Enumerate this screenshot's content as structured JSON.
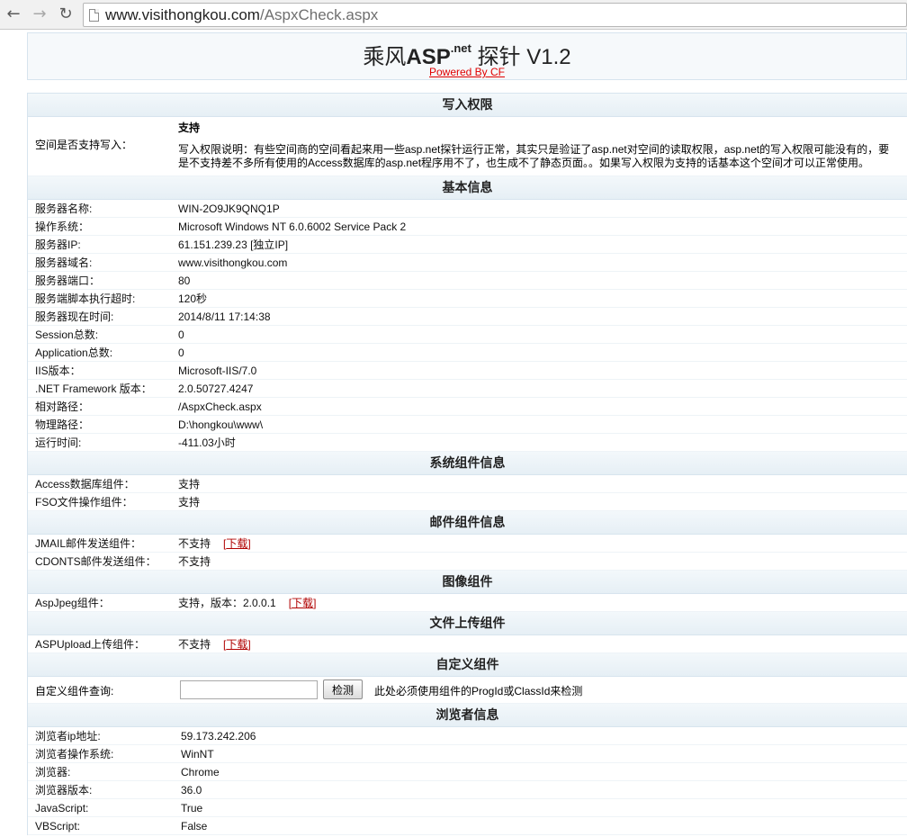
{
  "browser": {
    "url_host": "www.visithongkou.com",
    "url_path": "/AspxCheck.aspx"
  },
  "header": {
    "title_prefix": "乘风",
    "title_asp": "ASP",
    "title_net": ".net",
    "title_suffix": " 探针 V1.2",
    "powered": "Powered By CF"
  },
  "write": {
    "heading": "写入权限",
    "label": "空间是否支持写入：",
    "value": "支持",
    "note": "写入权限说明：有些空间商的空间看起来用一些asp.net探针运行正常，其实只是验证了asp.net对空间的读取权限，asp.net的写入权限可能没有的，要是不支持差不多所有使用的Access数据库的asp.net程序用不了，也生成不了静态页面。。如果写入权限为支持的话基本这个空间才可以正常使用。"
  },
  "basic": {
    "heading": "基本信息",
    "rows": [
      {
        "label": "服务器名称:",
        "value": "WIN-2O9JK9QNQ1P"
      },
      {
        "label": "操作系统：",
        "value": "Microsoft Windows NT 6.0.6002 Service Pack 2"
      },
      {
        "label": "服务器IP:",
        "value": "61.151.239.23 [独立IP]"
      },
      {
        "label": "服务器域名:",
        "value": "www.visithongkou.com"
      },
      {
        "label": "服务器端口：",
        "value": "80"
      },
      {
        "label": "服务端脚本执行超时:",
        "value": "120秒"
      },
      {
        "label": "服务器现在时间:",
        "value": "2014/8/11 17:14:38"
      },
      {
        "label": "Session总数:",
        "value": "0"
      },
      {
        "label": "Application总数:",
        "value": "0"
      },
      {
        "label": "IIS版本：",
        "value": "Microsoft-IIS/7.0"
      },
      {
        "label": ".NET Framework 版本：",
        "value": "2.0.50727.4247"
      },
      {
        "label": "相对路径：",
        "value": "/AspxCheck.aspx"
      },
      {
        "label": "物理路径：",
        "value": "D:\\hongkou\\www\\"
      },
      {
        "label": "运行时间:",
        "value": "-411.03小时"
      }
    ]
  },
  "system": {
    "heading": "系统组件信息",
    "rows": [
      {
        "label": "Access数据库组件：",
        "value": "支持"
      },
      {
        "label": "FSO文件操作组件：",
        "value": "支持"
      }
    ]
  },
  "mail": {
    "heading": "邮件组件信息",
    "rows": [
      {
        "label": "JMAIL邮件发送组件：",
        "value": "不支持",
        "link": "下载"
      },
      {
        "label": "CDONTS邮件发送组件：",
        "value": "不支持"
      }
    ]
  },
  "image": {
    "heading": "图像组件",
    "rows": [
      {
        "label": "AspJpeg组件：",
        "value": "支持，版本：2.0.0.1",
        "link": "下载"
      }
    ]
  },
  "upload": {
    "heading": "文件上传组件",
    "rows": [
      {
        "label": "ASPUpload上传组件：",
        "value": "不支持",
        "link": "下载"
      }
    ]
  },
  "custom": {
    "heading": "自定义组件",
    "label": "自定义组件查询:",
    "input_value": "",
    "button": "检测",
    "hint": "此处必须使用组件的ProgId或ClassId来检测"
  },
  "browser_info": {
    "heading": "浏览者信息",
    "rows": [
      {
        "label": "浏览者ip地址:",
        "value": "59.173.242.206"
      },
      {
        "label": "浏览者操作系统:",
        "value": "WinNT"
      },
      {
        "label": "浏览器:",
        "value": "Chrome"
      },
      {
        "label": "浏览器版本:",
        "value": "36.0"
      },
      {
        "label": "JavaScript:",
        "value": "True"
      },
      {
        "label": "VBScript:",
        "value": "False"
      }
    ]
  }
}
